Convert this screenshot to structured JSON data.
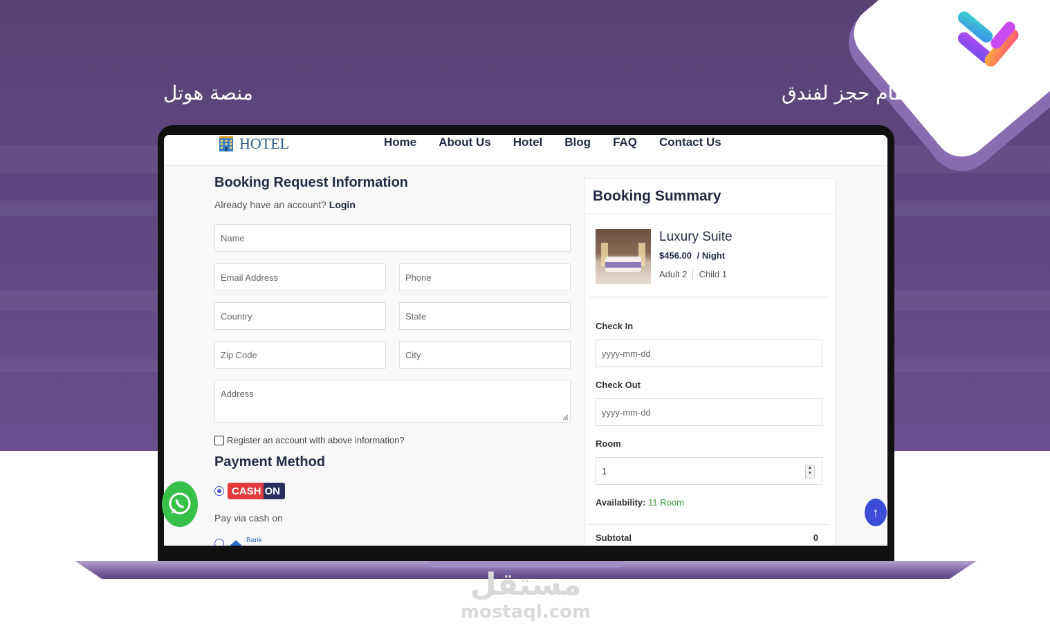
{
  "banner": {
    "right_text": "نظام حجز لفندق",
    "left_text": "منصة هوتل"
  },
  "nav": {
    "brand": "HOTEL",
    "links": [
      "Home",
      "About Us",
      "Hotel",
      "Blog",
      "FAQ",
      "Contact Us"
    ]
  },
  "booking": {
    "title": "Booking Request Information",
    "account_prompt": "Already have an account?",
    "login_link": "Login",
    "placeholders": {
      "name": "Name",
      "email": "Email Address",
      "phone": "Phone",
      "country": "Country",
      "state": "State",
      "zip": "Zip Code",
      "city": "City",
      "address": "Address"
    },
    "register_label": "Register an account with above information?",
    "register_checked": false
  },
  "payment": {
    "title": "Payment Method",
    "cash_badge_red": "CASH",
    "cash_badge_navy": "ON",
    "cash_selected": true,
    "cash_desc": "Pay via cash on",
    "bank_label": "Bank"
  },
  "summary": {
    "title": "Booking Summary",
    "room_name": "Luxury Suite",
    "room_price": "$456.00",
    "room_price_unit": "/ Night",
    "adults": "Adult 2",
    "children": "Child 1",
    "check_in_label": "Check In",
    "check_in_placeholder": "yyyy-mm-dd",
    "check_out_label": "Check Out",
    "check_out_placeholder": "yyyy-mm-dd",
    "room_label": "Room",
    "room_value": "1",
    "availability_label": "Availability:",
    "availability_value": "11 Room",
    "subtotal_label": "Subtotal",
    "subtotal_value": "0"
  },
  "watermark": {
    "arabic": "مستقل",
    "latin": "mostaql.com"
  },
  "colors": {
    "banner_purple": "#5f4680",
    "nav_text": "#1f2a44",
    "accent_blue": "#3d4cd8",
    "whatsapp_green": "#37c04a",
    "availability_green": "#2e9a3a"
  }
}
